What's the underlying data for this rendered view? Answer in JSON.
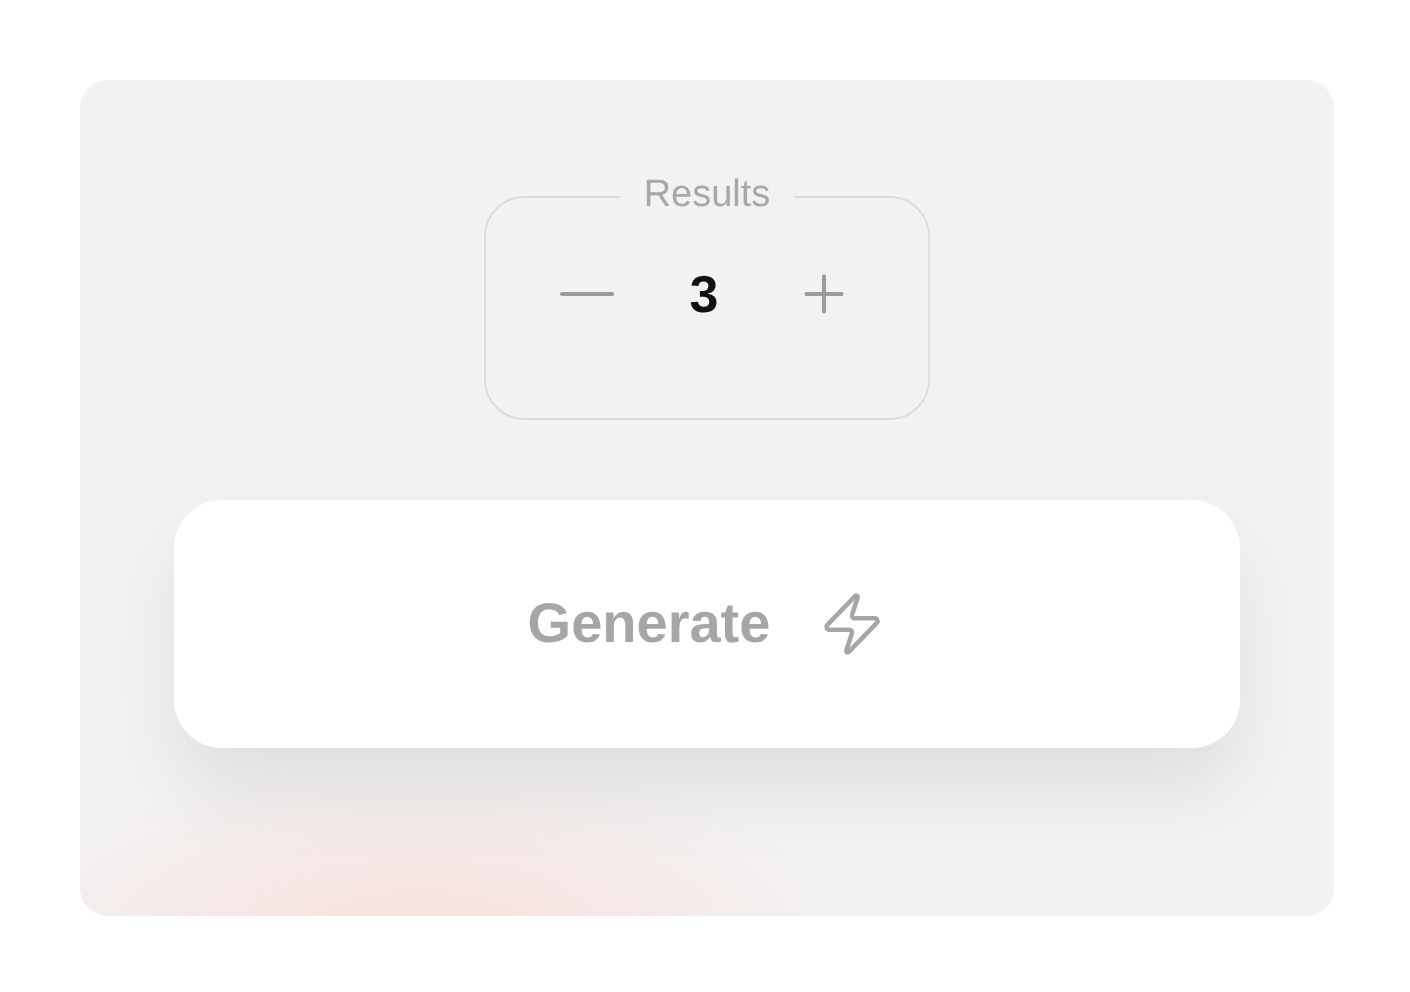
{
  "stepper": {
    "label": "Results",
    "value": "3"
  },
  "generate_button": {
    "label": "Generate"
  }
}
